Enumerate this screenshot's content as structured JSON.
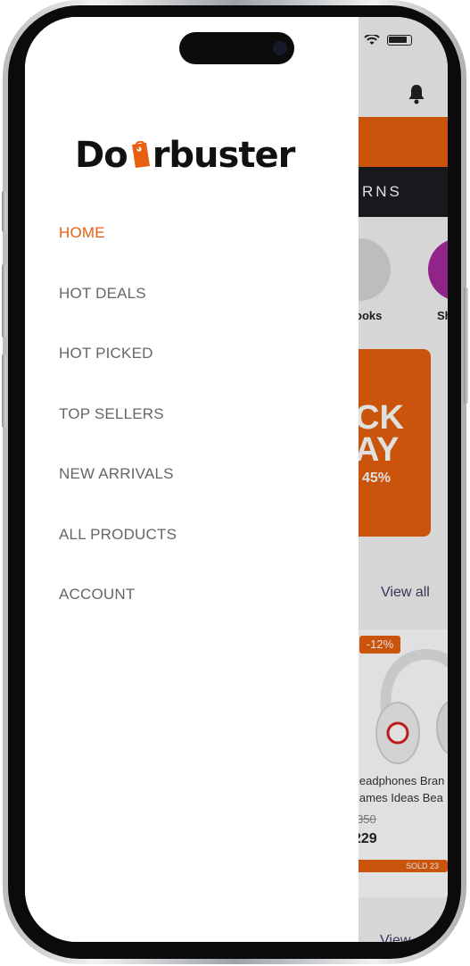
{
  "background_screen": {
    "tab_text": "RNS",
    "categories": [
      {
        "label": "ooks"
      },
      {
        "label": "Sh"
      }
    ],
    "promo": {
      "line1": "CK",
      "line2": "AY",
      "discount": "45%"
    },
    "view_all_label": "View all",
    "product": {
      "discount_badge": "-12%",
      "name_line1": "leadphones Bran",
      "name_line2": "lames Ideas Bea",
      "old_price": "350",
      "new_price": "229",
      "sold_text": "SOLD 23"
    },
    "view_bottom_label": "View"
  },
  "drawer": {
    "logo_text_left": "Do",
    "logo_text_right": "rbuster",
    "menu": [
      {
        "label": "HOME",
        "active": true
      },
      {
        "label": "HOT DEALS",
        "active": false
      },
      {
        "label": "HOT PICKED",
        "active": false
      },
      {
        "label": "TOP SELLERS",
        "active": false
      },
      {
        "label": "NEW ARRIVALS",
        "active": false
      },
      {
        "label": "ALL PRODUCTS",
        "active": false
      },
      {
        "label": "ACCOUNT",
        "active": false
      }
    ]
  },
  "colors": {
    "accent": "#e8600f",
    "menu_text": "#666666",
    "dark_band": "#1c1d22"
  },
  "icons": [
    "wifi-icon",
    "battery-icon",
    "bell-icon",
    "tag-icon",
    "headphones-image"
  ]
}
